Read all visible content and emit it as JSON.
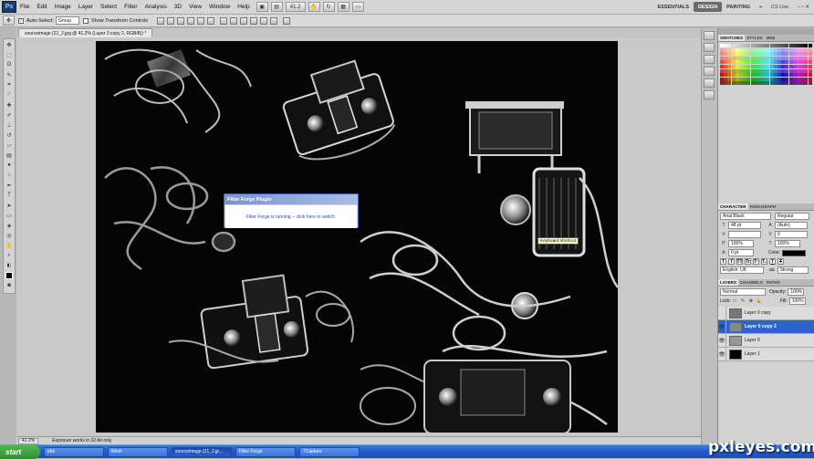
{
  "menubar": {
    "logo": "Ps",
    "items": [
      "File",
      "Edit",
      "Image",
      "Layer",
      "Select",
      "Filter",
      "Analysis",
      "3D",
      "View",
      "Window",
      "Help"
    ],
    "zoom": "41.2",
    "workspaces": [
      "ESSENTIALS",
      "DESIGN",
      "PAINTING"
    ],
    "more": "»",
    "cslive": "CS Live"
  },
  "options": {
    "auto_select_label": "Auto-Select:",
    "auto_select_value": "Group",
    "transform_label": "Show Transform Controls"
  },
  "document": {
    "tab_title": "sourceimage (21_2.jpg @ 41.2% (Layer 0 copy 2, RGB/8)) *"
  },
  "dialog": {
    "title": "Filter Forge Plugin",
    "message": "Filter Forge is running -- click here to switch."
  },
  "tooltip": {
    "text": "Keyboard shortcut"
  },
  "status": {
    "zoom": "41.2%",
    "info": "Exposure works in 32-bit only"
  },
  "panels": {
    "swatch_tabs": [
      "SWATCHES",
      "STYLES",
      "MINI"
    ],
    "char_tabs": [
      "CHARACTER",
      "PARAGRAPH"
    ],
    "font_family": "Arial Black",
    "font_style": "Regular",
    "font_size": "48 pt",
    "leading": "(Auto)",
    "kerning": "0",
    "vscale": "100%",
    "hscale": "100%",
    "baseline": "0 pt",
    "color_label": "Color:",
    "language": "English: UK",
    "antialias": "Strong",
    "aa_label": "aa",
    "format_buttons": [
      "T",
      "T",
      "TT",
      "Tr",
      "T¹",
      "T₁",
      "T",
      "T"
    ],
    "layer_tabs": [
      "LAYERS",
      "CHANNELS",
      "PATHS"
    ],
    "blend_mode": "Normal",
    "opacity_label": "Opacity:",
    "opacity": "100%",
    "lock_label": "Lock:",
    "fill_label": "Fill:",
    "fill": "100%",
    "layers": [
      {
        "name": "Layer 0 copy",
        "visible": false,
        "selected": false
      },
      {
        "name": "Layer 0 copy 2",
        "visible": true,
        "selected": true
      },
      {
        "name": "Layer 0",
        "visible": true,
        "selected": false
      },
      {
        "name": "Layer 1",
        "visible": true,
        "selected": false
      }
    ]
  },
  "taskbar": {
    "start": "start",
    "buttons": [
      "phs",
      "finish",
      "sourceimage (21_2.jp...",
      "Filter Forge",
      "7Capture"
    ],
    "active_index": 2
  },
  "watermark": "pxleyes.com"
}
